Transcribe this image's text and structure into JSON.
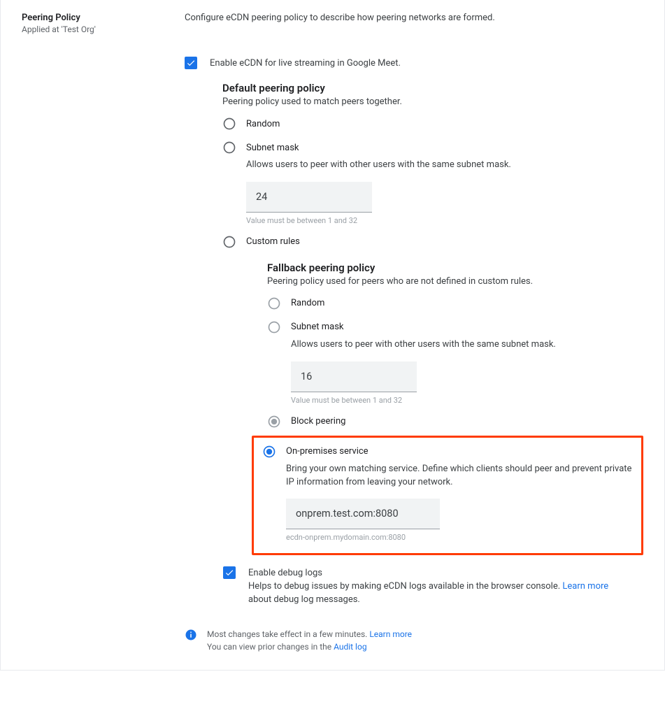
{
  "sidebar": {
    "title": "Peering Policy",
    "applied_at": "Applied at 'Test Org'"
  },
  "main": {
    "description": "Configure eCDN peering policy to describe how peering networks are formed.",
    "enable_ecdn": {
      "checked": true,
      "label": "Enable eCDN for live streaming in Google Meet."
    },
    "default_policy": {
      "title": "Default peering policy",
      "desc": "Peering policy used to match peers together.",
      "options": {
        "random": {
          "label": "Random",
          "selected": false
        },
        "subnet": {
          "label": "Subnet mask",
          "selected": false,
          "desc": "Allows users to peer with other users with the same subnet mask.",
          "input_value": "24",
          "input_helper": "Value must be between 1 and 32"
        },
        "custom": {
          "label": "Custom rules",
          "selected": false
        }
      }
    },
    "fallback_policy": {
      "title": "Fallback peering policy",
      "desc": "Peering policy used for peers who are not defined in custom rules.",
      "options": {
        "random": {
          "label": "Random",
          "selected": false
        },
        "subnet": {
          "label": "Subnet mask",
          "selected": false,
          "desc": "Allows users to peer with other users with the same subnet mask.",
          "input_value": "16",
          "input_helper": "Value must be between 1 and 32"
        },
        "block": {
          "label": "Block peering",
          "selected": false,
          "disabled_look": true
        }
      }
    },
    "onprem": {
      "label": "On-premises service",
      "selected": true,
      "desc": "Bring your own matching service. Define which clients should peer and prevent private IP information from leaving your network.",
      "input_value": "onprem.test.com:8080",
      "input_helper": "ecdn-onprem.mydomain.com:8080"
    },
    "debug": {
      "checked": true,
      "label": "Enable debug logs",
      "desc_pre": "Helps to debug issues by making eCDN logs available in the browser console. ",
      "learn_more": "Learn more",
      "desc_post": " about debug log messages."
    },
    "info": {
      "line1_pre": "Most changes take effect in a few minutes. ",
      "line1_link": "Learn more",
      "line2_pre": "You can view prior changes in the ",
      "line2_link": "Audit log"
    }
  }
}
